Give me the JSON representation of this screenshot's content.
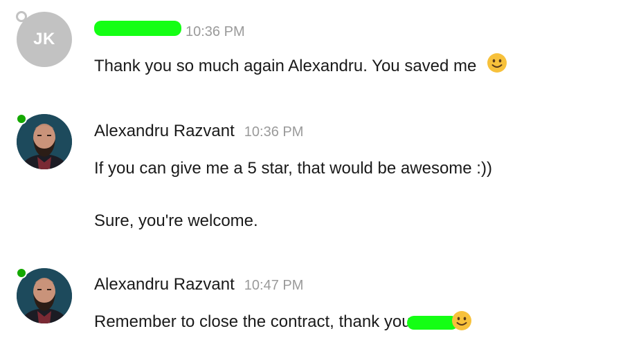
{
  "messages": [
    {
      "avatar_initials": "JK",
      "status": "offline",
      "sender": "",
      "sender_redacted": true,
      "time": "10:36 PM",
      "lines": [
        "Thank you so much again Alexandru. You saved me"
      ],
      "emoji": "slightly-smiling-face-icon"
    },
    {
      "sender": "Alexandru Razvant",
      "status": "online",
      "time": "10:36 PM",
      "lines": [
        "If you can give me a 5 star, that would be awesome :))",
        "Sure, you're welcome."
      ]
    },
    {
      "sender": "Alexandru Razvant",
      "status": "online",
      "time": "10:47 PM",
      "lines": [
        "Remember to close the contract, thank you"
      ],
      "recipient_redacted": true,
      "emoji": "slightly-smiling-face-icon"
    }
  ],
  "colors": {
    "online": "#14a800",
    "offline_avatar": "#c2c2c2",
    "timestamp": "#9a9a9a",
    "text": "#1a1a1a",
    "redaction": "#14ff14",
    "emoji": "#f7c13b"
  }
}
